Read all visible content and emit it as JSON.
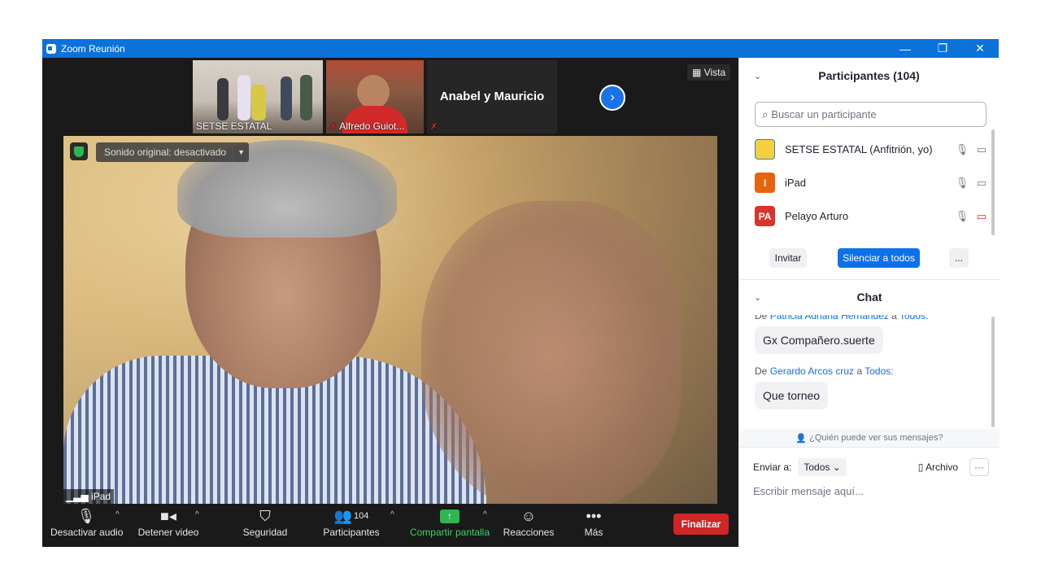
{
  "window": {
    "title": "Zoom Reunión",
    "minimize": "—",
    "maximize": "❐",
    "close": "✕"
  },
  "video": {
    "thumbnails": [
      {
        "name": "SETSE ESTATAL",
        "muted": false
      },
      {
        "name": "Alfredo Guiot...",
        "muted": true
      },
      {
        "name": "",
        "big_name": "Anabel y Mauricio",
        "muted": true
      }
    ],
    "view_label": "Vista",
    "sound_original": "Sonido original: desactivado",
    "main_speaker_label": "iPad"
  },
  "toolbar": {
    "audio": "Desactivar audio",
    "video": "Detener video",
    "security": "Seguridad",
    "participants": "Participantes",
    "participants_count": "104",
    "share": "Compartir pantalla",
    "reactions": "Reacciones",
    "more": "Más",
    "end": "Finalizar"
  },
  "participants_panel": {
    "title": "Participantes (104)",
    "search_placeholder": "Buscar un participante",
    "participants": [
      {
        "name": "SETSE ESTATAL (Anfitrión, yo)",
        "initials": "",
        "avatar_color": "#f4d03f",
        "video_off": false
      },
      {
        "name": "iPad",
        "initials": "I",
        "avatar_color": "#e8640c",
        "video_off": false
      },
      {
        "name": "Pelayo Arturo",
        "initials": "PA",
        "avatar_color": "#d9342b",
        "video_off": true
      }
    ],
    "invite": "Invitar",
    "mute_all": "Silenciar a todos",
    "more": "..."
  },
  "chat": {
    "title": "Chat",
    "messages": [
      {
        "prefix": "De",
        "from": "Patricia Adriana Hernandez",
        "to_word": "a",
        "to": "Todos:",
        "text": "Gx Compañero.suerte"
      },
      {
        "prefix": "De",
        "from": "Gerardo Arcos cruz",
        "to_word": "a",
        "to": "Todos:",
        "text": "Que torneo"
      }
    ],
    "who_can_see": "¿Quién puede ver sus mensajes?",
    "send_to_label": "Enviar a:",
    "send_to_value": "Todos",
    "file_label": "Archivo",
    "more": "···",
    "input_placeholder": "Escribir mensaje aquí..."
  }
}
